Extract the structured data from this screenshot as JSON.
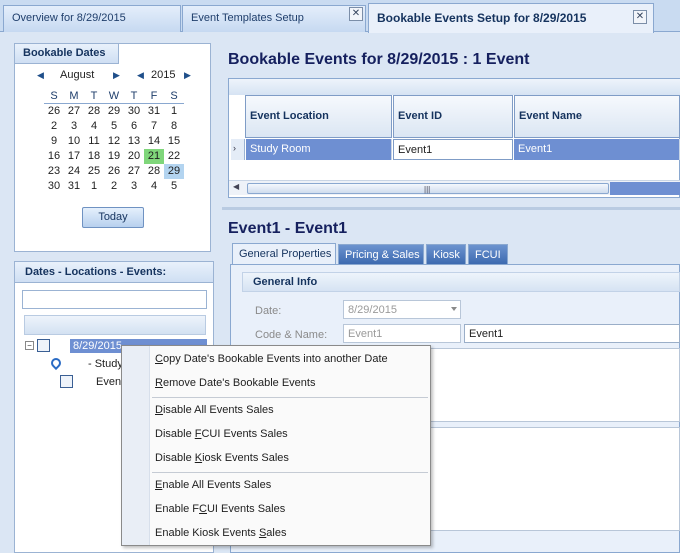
{
  "tabs": [
    {
      "label": "Overview for 8/29/2015"
    },
    {
      "label": "Event Templates Setup",
      "close": "✕"
    },
    {
      "label": "Bookable Events Setup for 8/29/2015",
      "close": "✕"
    }
  ],
  "calendar": {
    "group_title": "Bookable Dates",
    "month": "August",
    "year": "2015",
    "weekdays": [
      "S",
      "M",
      "T",
      "W",
      "T",
      "F",
      "S"
    ],
    "weeks": [
      [
        "26",
        "27",
        "28",
        "29",
        "30",
        "31",
        "1"
      ],
      [
        "2",
        "3",
        "4",
        "5",
        "6",
        "7",
        "8"
      ],
      [
        "9",
        "10",
        "11",
        "12",
        "13",
        "14",
        "15"
      ],
      [
        "16",
        "17",
        "18",
        "19",
        "20",
        "21",
        "22"
      ],
      [
        "23",
        "24",
        "25",
        "26",
        "27",
        "28",
        "29"
      ],
      [
        "30",
        "31",
        "1",
        "2",
        "3",
        "4",
        "5"
      ]
    ],
    "today_date": "21",
    "selected_date": "29",
    "today_button": "Today",
    "today_color": "#7fd67a",
    "selected_color": "#b3d4f0"
  },
  "tree": {
    "title": "Dates - Locations - Events:",
    "filter_value": "",
    "nodes": [
      {
        "label": "8/29/2015",
        "icon": "calendar-icon"
      },
      {
        "label": "- Study",
        "icon": "location-pin-icon"
      },
      {
        "label": "Even",
        "icon": "event-icon"
      }
    ]
  },
  "grid": {
    "title": "Bookable Events for 8/29/2015  :  1 Event",
    "columns": [
      "Event Location",
      "Event ID",
      "Event Name"
    ],
    "rows": [
      {
        "indicator": "›",
        "cells": [
          "Study Room",
          "Event1",
          "Event1"
        ]
      }
    ]
  },
  "detail": {
    "title": "Event1  -  Event1",
    "tabs": [
      "General Properties",
      "Pricing & Sales",
      "Kiosk",
      "FCUI"
    ],
    "section": "General Info",
    "date_label": "Date:",
    "date_value": "8/29/2015",
    "code_label": "Code & Name:",
    "code_value": "Event1",
    "name_value": "Event1"
  },
  "context_menu": {
    "items": [
      {
        "pre": "",
        "u": "C",
        "post": "opy Date's Bookable Events into another Date"
      },
      {
        "pre": "",
        "u": "R",
        "post": "emove Date's Bookable Events"
      },
      {
        "pre": "",
        "u": "D",
        "post": "isable All Events Sales"
      },
      {
        "pre": "Disable ",
        "u": "F",
        "post": "CUI Events Sales"
      },
      {
        "pre": "Disable ",
        "u": "K",
        "post": "iosk Events Sales"
      },
      {
        "pre": "",
        "u": "E",
        "post": "nable All Events Sales"
      },
      {
        "pre": "Enable F",
        "u": "C",
        "post": "UI Events Sales"
      },
      {
        "pre": "Enable Kiosk Events ",
        "u": "S",
        "post": "ales"
      }
    ]
  },
  "colors": {
    "accent": "#15205e",
    "selection": "#6e8fd2",
    "tab_blue": "#3d6ab0"
  }
}
